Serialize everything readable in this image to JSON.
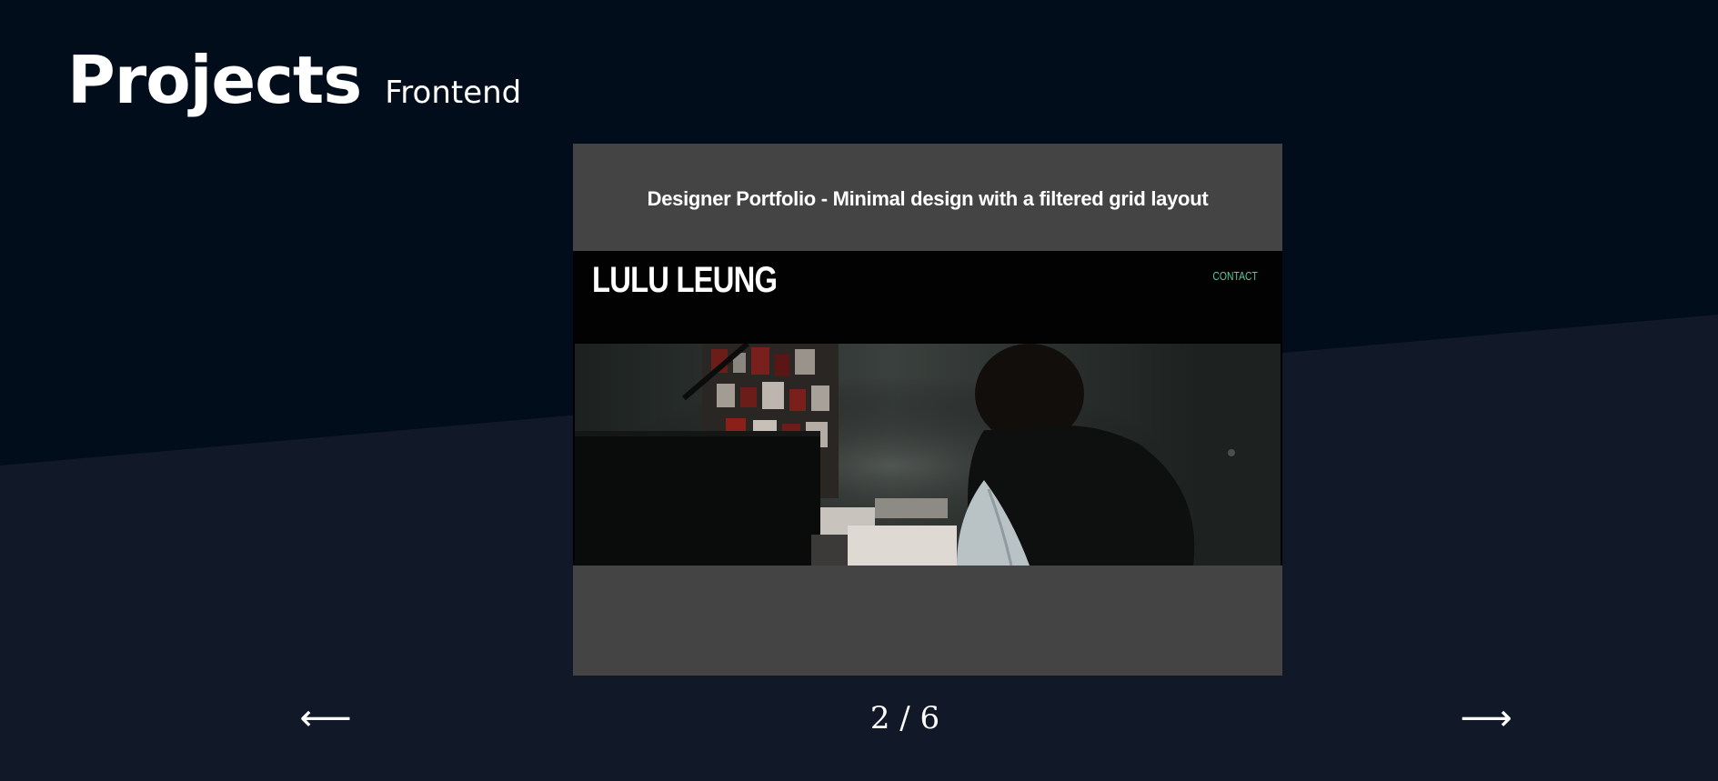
{
  "header": {
    "title": "Projects",
    "subtitle": "Frontend"
  },
  "colors": {
    "background_top": "#010d1a",
    "background_bottom": "#111827",
    "card": "#444444",
    "accent_contact": "#5cc9a0"
  },
  "slide": {
    "caption": "Designer Portfolio - Minimal design with a filtered grid layout",
    "preview": {
      "logo": "LULU LEUNG",
      "nav_link": "CONTACT"
    }
  },
  "pager": {
    "prev_icon": "arrow-left-icon",
    "next_icon": "arrow-right-icon",
    "prev_glyph": "⟵",
    "next_glyph": "⟶",
    "current": "2",
    "separator": "/",
    "total": "6",
    "label": "2 / 6"
  }
}
